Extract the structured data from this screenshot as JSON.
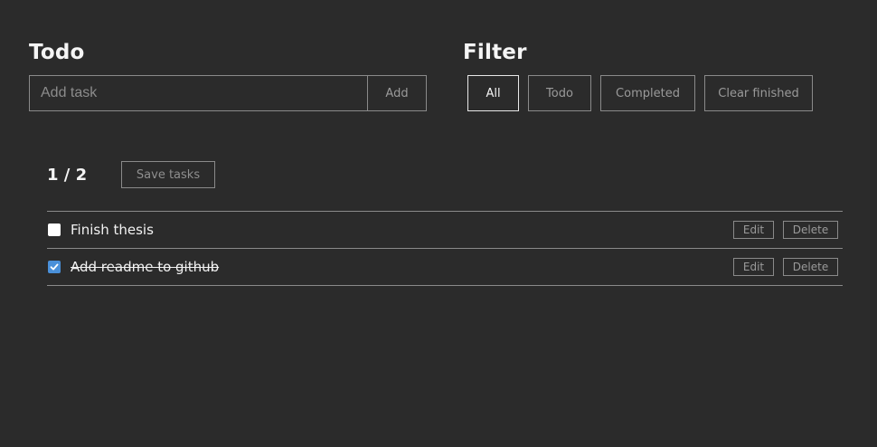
{
  "todo_section": {
    "title": "Todo",
    "input_placeholder": "Add task",
    "input_value": "",
    "add_label": "Add"
  },
  "filter_section": {
    "title": "Filter",
    "buttons": [
      {
        "label": "All",
        "active": true
      },
      {
        "label": "Todo",
        "active": false
      },
      {
        "label": "Completed",
        "active": false
      },
      {
        "label": "Clear finished",
        "active": false
      }
    ]
  },
  "summary": {
    "counter": "1 / 2",
    "save_label": "Save tasks"
  },
  "tasks": [
    {
      "text": "Finish thesis",
      "completed": false,
      "edit_label": "Edit",
      "delete_label": "Delete"
    },
    {
      "text": "Add readme to github",
      "completed": true,
      "edit_label": "Edit",
      "delete_label": "Delete"
    }
  ],
  "colors": {
    "background": "#2b2b2b",
    "border": "#8a8a8a",
    "checkbox_checked": "#4a90d9"
  },
  "icons": {
    "checkbox_checked": "checkmark-icon"
  }
}
